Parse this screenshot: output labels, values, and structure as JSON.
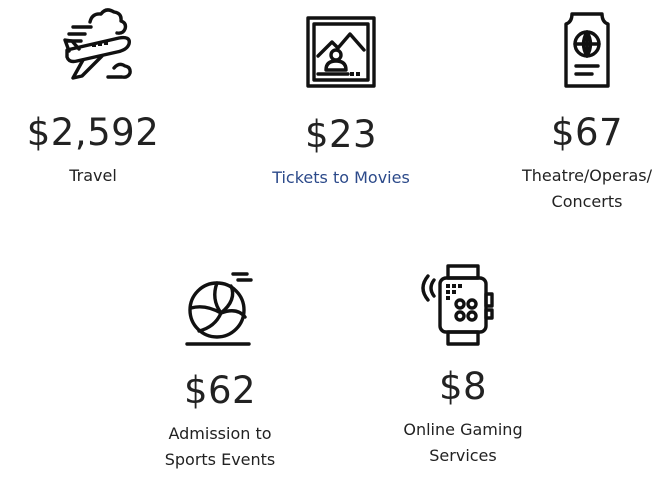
{
  "items": [
    {
      "icon": "airplane-clouds-icon",
      "amount": "$2,592",
      "label": "Travel"
    },
    {
      "icon": "movie-ticket-icon",
      "amount": "$23",
      "label": "Tickets to Movies",
      "label_color": "#2c4a8a"
    },
    {
      "icon": "concert-ticket-icon",
      "amount": "$67",
      "label": "Theatre/Operas/ Concerts"
    },
    {
      "icon": "volleyball-icon",
      "amount": "$62",
      "label": "Admission to Sports Events"
    },
    {
      "icon": "gaming-device-icon",
      "amount": "$8",
      "label": "Online Gaming Services"
    }
  ],
  "colors": {
    "text": "#222222",
    "link": "#2c4a8a",
    "icon": "#111111"
  }
}
